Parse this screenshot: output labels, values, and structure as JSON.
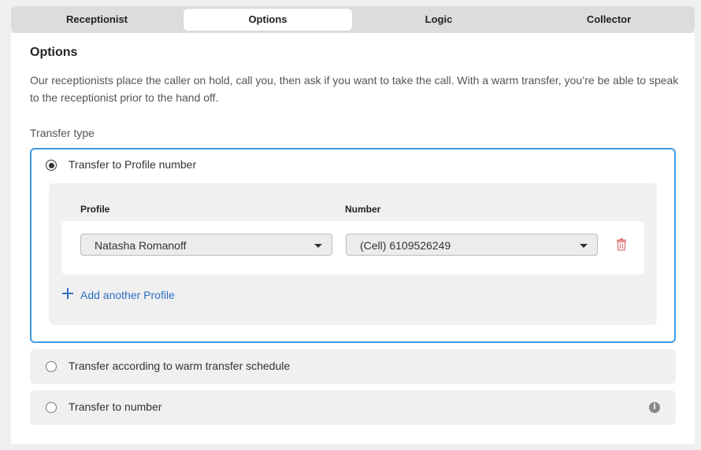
{
  "tabs": [
    {
      "label": "Receptionist"
    },
    {
      "label": "Options"
    },
    {
      "label": "Logic"
    },
    {
      "label": "Collector"
    }
  ],
  "active_tab": "Options",
  "section": {
    "title": "Options",
    "description": "Our receptionists place the caller on hold, call you, then ask if you want to take the call. With a warm transfer, you’re be able to speak to the receptionist prior to the hand off.",
    "transfer_type_label": "Transfer type"
  },
  "options": [
    {
      "label": "Transfer to Profile number",
      "selected": true
    },
    {
      "label": "Transfer according to warm transfer schedule",
      "selected": false
    },
    {
      "label": "Transfer to number",
      "selected": false
    }
  ],
  "profile_table": {
    "profile_header": "Profile",
    "number_header": "Number",
    "rows": [
      {
        "profile": "Natasha Romanoff",
        "number": "(Cell) 6109526249"
      }
    ],
    "add_label": "Add another Profile"
  },
  "icons": {
    "trash": "trash-icon",
    "add": "plus-icon",
    "info": "info-icon",
    "dropdown": "chevron-down-icon"
  },
  "colors": {
    "accent": "#3d9be0",
    "link": "#2f6fc4",
    "trash": "#e07a7a"
  }
}
